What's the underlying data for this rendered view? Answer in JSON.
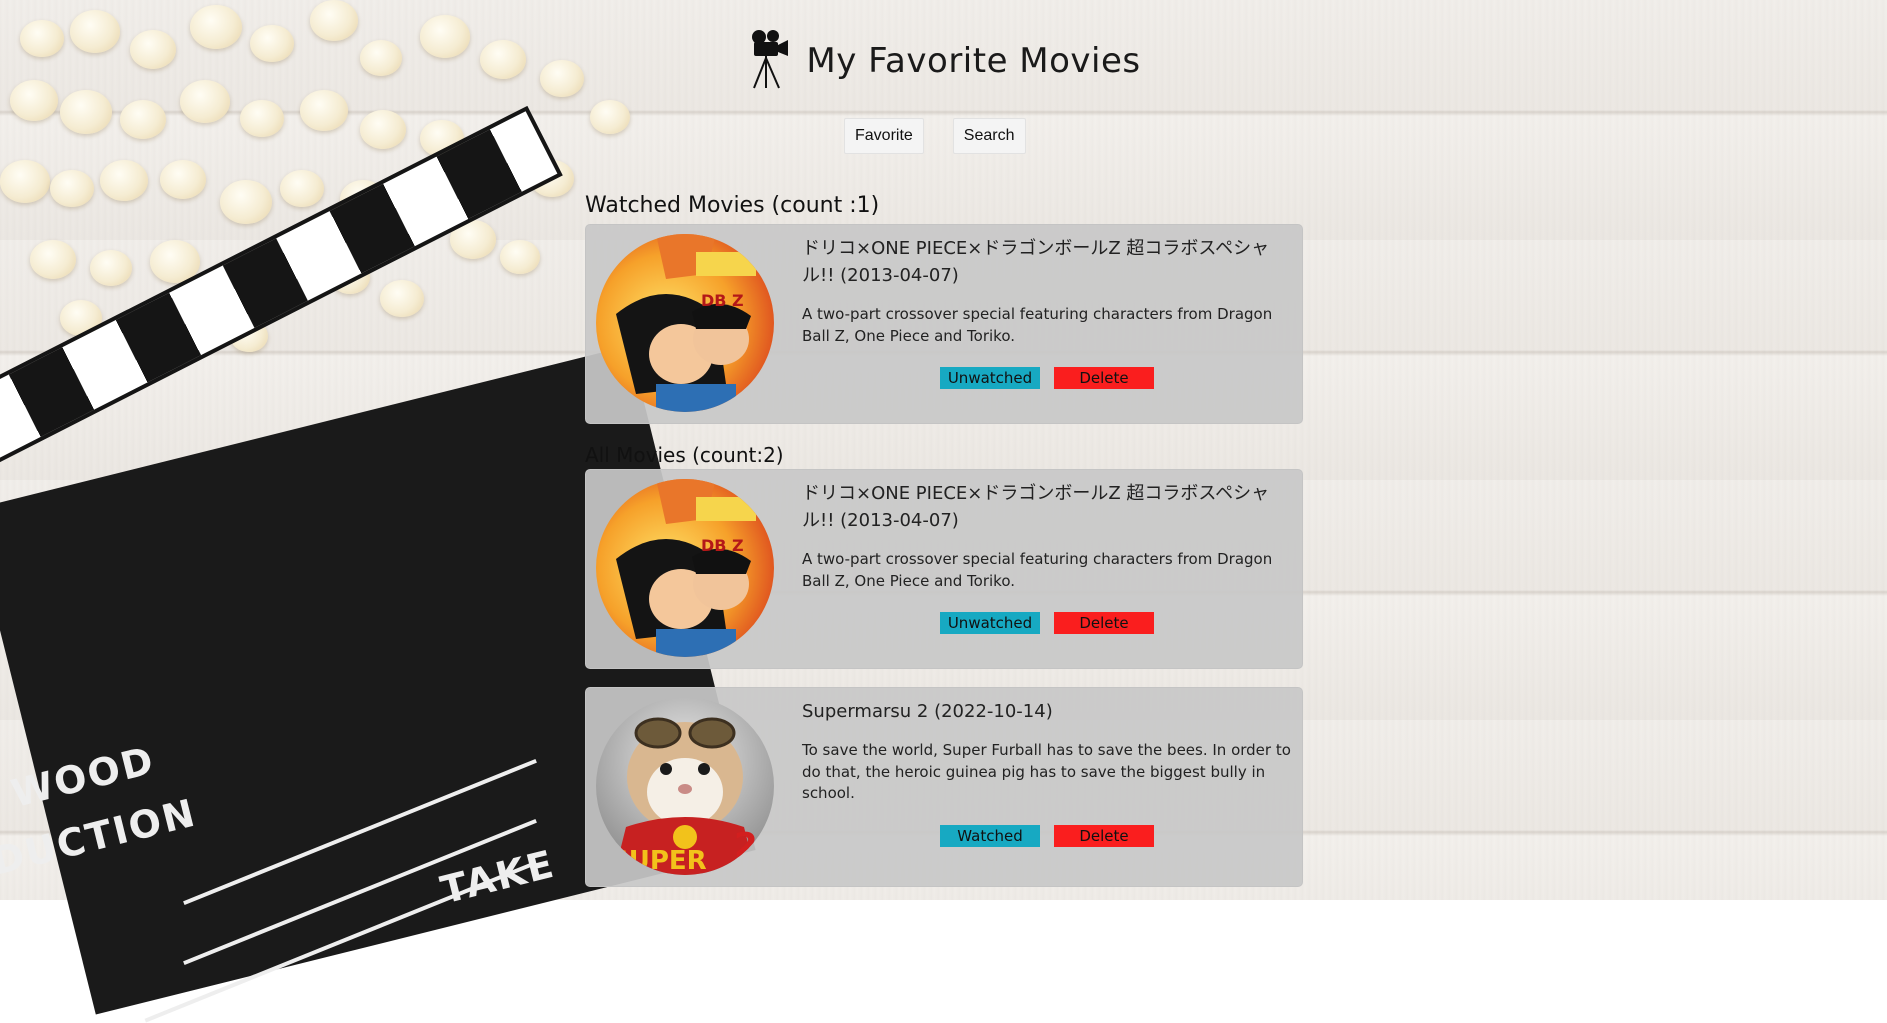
{
  "app": {
    "title": "My Favorite Movies",
    "logo_icon": "film-camera-icon"
  },
  "nav": {
    "favorite_label": "Favorite",
    "search_label": "Search"
  },
  "colors": {
    "watch_button": "#17a9c2",
    "delete_button": "#fa1e1e",
    "card_bg": "#c9c9c9"
  },
  "watched": {
    "heading": "Watched Movies (count :1)",
    "movies": [
      {
        "title": "ドリコ×ONE PIECE×ドラゴンボールZ 超コラボスペシャル!! (2013-04-07)",
        "overview": "A two-part crossover special featuring characters from Dragon Ball Z, One Piece and Toriko.",
        "toggle_label": "Unwatched",
        "delete_label": "Delete"
      }
    ]
  },
  "all": {
    "heading": "All Movies (count:2)",
    "movies": [
      {
        "title": "ドリコ×ONE PIECE×ドラゴンボールZ 超コラボスペシャル!! (2013-04-07)",
        "overview": "A two-part crossover special featuring characters from Dragon Ball Z, One Piece and Toriko.",
        "toggle_label": "Unwatched",
        "delete_label": "Delete"
      },
      {
        "title": "Supermarsu 2 (2022-10-14)",
        "overview": "To save the world, Super Furball has to save the bees. In order to do that, the heroic guinea pig has to save the biggest bully in school.",
        "toggle_label": "Watched",
        "delete_label": "Delete"
      }
    ]
  },
  "background": {
    "clapper_text": [
      "WOOD",
      "DUCTION",
      "TAKE"
    ]
  }
}
